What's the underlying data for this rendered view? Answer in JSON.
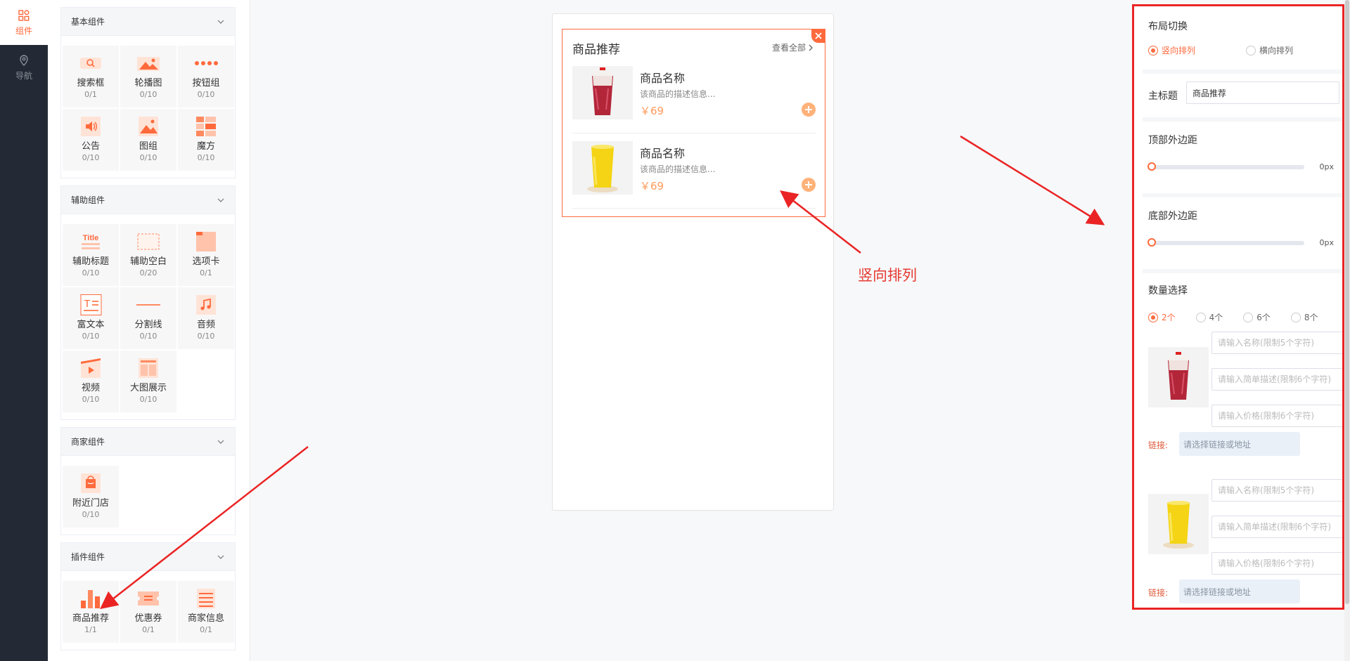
{
  "rail": {
    "items": [
      {
        "label": "组件",
        "icon": "components-icon",
        "active": true
      },
      {
        "label": "导航",
        "icon": "location-pin-icon",
        "active": false
      }
    ]
  },
  "panel": {
    "groups": [
      {
        "title": "基本组件",
        "items": [
          {
            "name": "搜索框",
            "count": "0/1",
            "icon": "search-icon"
          },
          {
            "name": "轮播图",
            "count": "0/10",
            "icon": "carousel-image-icon"
          },
          {
            "name": "按钮组",
            "count": "0/10",
            "icon": "button-group-icon"
          },
          {
            "name": "公告",
            "count": "0/10",
            "icon": "speaker-icon"
          },
          {
            "name": "图组",
            "count": "0/10",
            "icon": "image-icon"
          },
          {
            "name": "魔方",
            "count": "0/10",
            "icon": "cube-grid-icon"
          }
        ]
      },
      {
        "title": "辅助组件",
        "items": [
          {
            "name": "辅助标题",
            "count": "0/10",
            "icon": "title-icon"
          },
          {
            "name": "辅助空白",
            "count": "0/20",
            "icon": "blank-space-icon"
          },
          {
            "name": "选项卡",
            "count": "0/1",
            "icon": "tabs-icon"
          },
          {
            "name": "富文本",
            "count": "0/10",
            "icon": "rich-text-icon"
          },
          {
            "name": "分割线",
            "count": "0/10",
            "icon": "divider-line-icon"
          },
          {
            "name": "音频",
            "count": "0/10",
            "icon": "music-note-icon"
          },
          {
            "name": "视频",
            "count": "0/10",
            "icon": "video-play-icon"
          },
          {
            "name": "大图展示",
            "count": "0/10",
            "icon": "large-image-icon"
          }
        ]
      },
      {
        "title": "商家组件",
        "items": [
          {
            "name": "附近门店",
            "count": "0/10",
            "icon": "store-bag-icon"
          }
        ]
      },
      {
        "title": "插件组件",
        "items": [
          {
            "name": "商品推荐",
            "count": "1/1",
            "icon": "bar-chart-icon"
          },
          {
            "name": "优惠券",
            "count": "0/1",
            "icon": "coupon-icon"
          },
          {
            "name": "商家信息",
            "count": "0/1",
            "icon": "list-lines-icon"
          }
        ]
      }
    ]
  },
  "preview": {
    "title": "商品推荐",
    "more": "查看全部",
    "products": [
      {
        "name": "商品名称",
        "desc": "该商品的描述信息...",
        "price": "￥69",
        "image": "red-drink-cup"
      },
      {
        "name": "商品名称",
        "desc": "该商品的描述信息...",
        "price": "￥69",
        "image": "yellow-drink-cup"
      }
    ]
  },
  "annotation": {
    "text": "竖向排列"
  },
  "settings": {
    "layout": {
      "title": "布局切换",
      "options": [
        "竖向排列",
        "横向排列"
      ],
      "selected": "竖向排列"
    },
    "main_title": {
      "label": "主标题",
      "value": "商品推荐"
    },
    "top_margin": {
      "title": "顶部外边距",
      "value": "0px",
      "level": 0
    },
    "bottom_margin": {
      "title": "底部外边距",
      "value": "0px",
      "level": 0
    },
    "quantity": {
      "title": "数量选择",
      "options": [
        "2个",
        "4个",
        "6个",
        "8个"
      ],
      "selected": "2个"
    },
    "items": [
      {
        "name_placeholder": "请输入名称(限制5个字符)",
        "desc_placeholder": "请输入简单描述(限制6个字符)",
        "price_placeholder": "请输入价格(限制6个字符)",
        "link_label": "链接:",
        "link_placeholder": "请选择链接或地址"
      },
      {
        "name_placeholder": "请输入名称(限制5个字符)",
        "desc_placeholder": "请输入简单描述(限制6个字符)",
        "price_placeholder": "请输入价格(限制6个字符)",
        "link_label": "链接:",
        "link_placeholder": "请选择链接或地址"
      }
    ]
  },
  "colors": {
    "accent": "#ff6a3d",
    "rail_bg": "#242a35",
    "annotation_red": "#e53a32",
    "price": "#ff9a5c"
  }
}
